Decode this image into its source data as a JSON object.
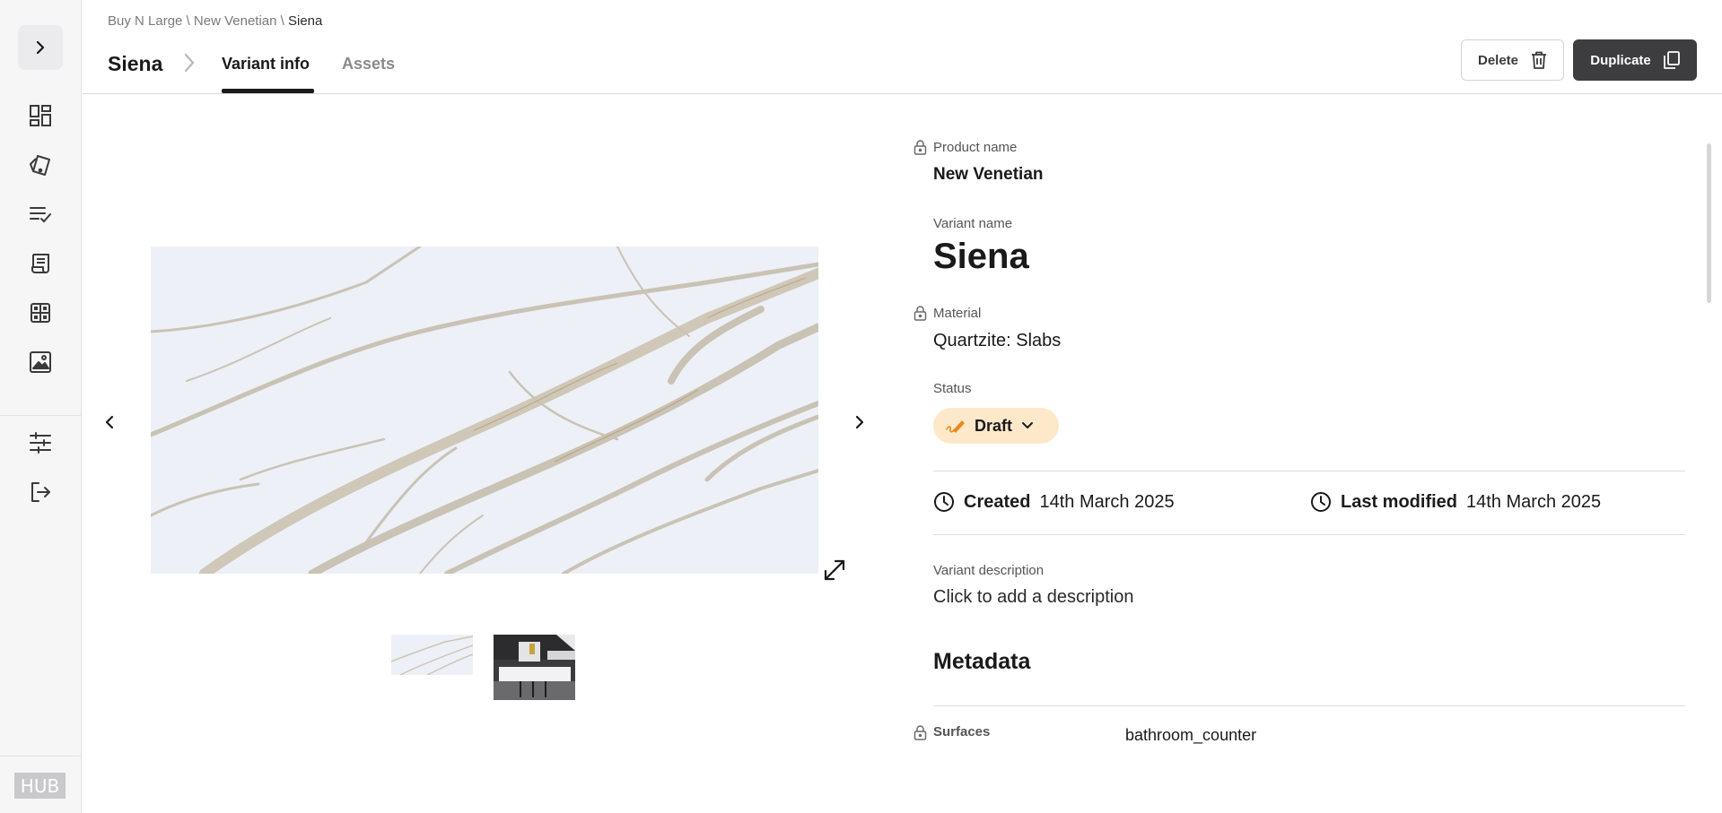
{
  "sidebar": {
    "expand_icon": "chevron-right-icon",
    "items": [
      {
        "name": "dashboard",
        "icon": "dashboard-icon"
      },
      {
        "name": "samples",
        "icon": "swatch-icon"
      },
      {
        "name": "checklist",
        "icon": "checklist-icon"
      },
      {
        "name": "orders",
        "icon": "receipt-icon"
      },
      {
        "name": "catalog",
        "icon": "grid-icon"
      },
      {
        "name": "media",
        "icon": "image-icon"
      }
    ],
    "bottom_items": [
      {
        "name": "settings",
        "icon": "sliders-icon"
      },
      {
        "name": "logout",
        "icon": "logout-icon"
      }
    ],
    "logo_text": "HUB"
  },
  "header": {
    "breadcrumb": {
      "part1": "Buy N Large",
      "sep1": " \\ ",
      "part2": "New Venetian",
      "sep2": " \\ ",
      "current": "Siena"
    },
    "title": "Siena",
    "tabs": [
      {
        "label": "Variant info",
        "active": true
      },
      {
        "label": "Assets",
        "active": false
      }
    ],
    "delete_label": "Delete",
    "duplicate_label": "Duplicate"
  },
  "details": {
    "product_name_label": "Product name",
    "product_name_value": "New Venetian",
    "variant_name_label": "Variant name",
    "variant_name_value": "Siena",
    "material_label": "Material",
    "material_value": "Quartzite: Slabs",
    "status_label": "Status",
    "status_value": "Draft",
    "created_label": "Created",
    "created_value": "14th March 2025",
    "modified_label": "Last modified",
    "modified_value": "14th March 2025",
    "description_label": "Variant description",
    "description_value": "Click to add a description",
    "metadata_heading": "Metadata",
    "surfaces_label": "Surfaces",
    "surfaces_value": "bathroom_counter"
  },
  "colors": {
    "accent_dark": "#3d3d3f",
    "status_bg": "#fde9c9",
    "status_icon": "#e58a1f",
    "sidebar_bg": "#f6f6f7"
  }
}
